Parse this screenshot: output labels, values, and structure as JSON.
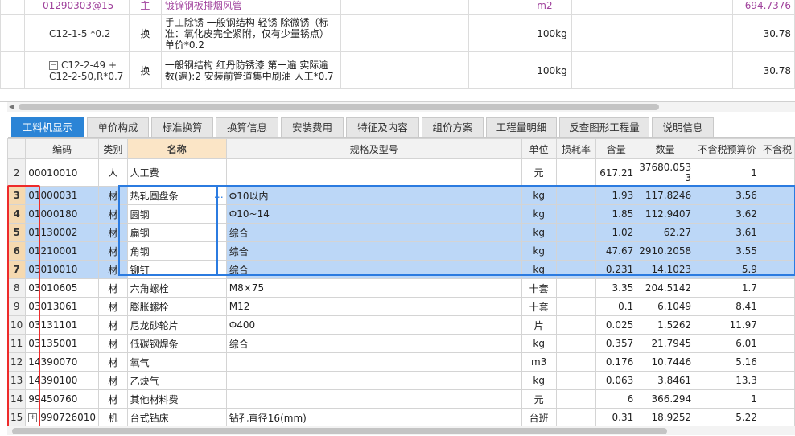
{
  "upper_grid": {
    "rows": [
      {
        "code": "01290303@15",
        "type": "主",
        "desc": "镀锌钢板排烟风管",
        "unit": "m2",
        "value": "694.7376"
      },
      {
        "code": "C12-1-5 *0.2",
        "type": "换",
        "desc": "手工除锈 一般钢结构 轻锈 除微锈（标准：氧化皮完全紧附，仅有少量锈点）单价*0.2",
        "unit": "100kg",
        "value": "30.78"
      },
      {
        "code": "C12-2-49 + C12-2-50,R*0.7",
        "type": "换",
        "desc": "一般钢结构 红丹防锈漆 第一遍 实际遍数(遍):2 安装前管道集中刷油 人工*0.7",
        "unit": "100kg",
        "value": "30.78"
      }
    ]
  },
  "tabs": [
    "工料机显示",
    "单价构成",
    "标准换算",
    "换算信息",
    "安装费用",
    "特征及内容",
    "组价方案",
    "工程量明细",
    "反查图形工程量",
    "说明信息"
  ],
  "columns": [
    "",
    "编码",
    "类别",
    "名称",
    "规格及型号",
    "单位",
    "损耗率",
    "含量",
    "数量",
    "不含税预算价",
    "不含税"
  ],
  "rows": [
    {
      "no": "2",
      "code": "00010010",
      "type": "人",
      "name": "人工费",
      "spec": "",
      "unit": "元",
      "loss": "",
      "qty": "617.21",
      "amount": "37680.0533",
      "price": "1",
      "sel": false
    },
    {
      "no": "3",
      "code": "01000031",
      "type": "材",
      "name": "热轧圆盘条",
      "spec": "Φ10以内",
      "unit": "kg",
      "loss": "",
      "qty": "1.93",
      "amount": "117.8246",
      "price": "3.56",
      "sel": true
    },
    {
      "no": "4",
      "code": "01000180",
      "type": "材",
      "name": "圆钢",
      "spec": "Φ10~14",
      "unit": "kg",
      "loss": "",
      "qty": "1.85",
      "amount": "112.9407",
      "price": "3.62",
      "sel": true
    },
    {
      "no": "5",
      "code": "01130002",
      "type": "材",
      "name": "扁钢",
      "spec": "综合",
      "unit": "kg",
      "loss": "",
      "qty": "1.02",
      "amount": "62.27",
      "price": "3.61",
      "sel": true
    },
    {
      "no": "6",
      "code": "01210001",
      "type": "材",
      "name": "角钢",
      "spec": "综合",
      "unit": "kg",
      "loss": "",
      "qty": "47.67",
      "amount": "2910.2058",
      "price": "3.55",
      "sel": true
    },
    {
      "no": "7",
      "code": "03010010",
      "type": "材",
      "name": "铆钉",
      "spec": "综合",
      "unit": "kg",
      "loss": "",
      "qty": "0.231",
      "amount": "14.1023",
      "price": "5.9",
      "sel": true
    },
    {
      "no": "8",
      "code": "03010605",
      "type": "材",
      "name": "六角螺栓",
      "spec": "M8×75",
      "unit": "十套",
      "loss": "",
      "qty": "3.35",
      "amount": "204.5142",
      "price": "1.7",
      "sel": false
    },
    {
      "no": "9",
      "code": "03013061",
      "type": "材",
      "name": "膨胀螺栓",
      "spec": "M12",
      "unit": "十套",
      "loss": "",
      "qty": "0.1",
      "amount": "6.1049",
      "price": "8.41",
      "sel": false
    },
    {
      "no": "10",
      "code": "03131101",
      "type": "材",
      "name": "尼龙砂轮片",
      "spec": "Φ400",
      "unit": "片",
      "loss": "",
      "qty": "0.025",
      "amount": "1.5262",
      "price": "11.97",
      "sel": false
    },
    {
      "no": "11",
      "code": "03135001",
      "type": "材",
      "name": "低碳钢焊条",
      "spec": "综合",
      "unit": "kg",
      "loss": "",
      "qty": "0.357",
      "amount": "21.7945",
      "price": "6.01",
      "sel": false
    },
    {
      "no": "12",
      "code": "14390070",
      "type": "材",
      "name": "氧气",
      "spec": "",
      "unit": "m3",
      "loss": "",
      "qty": "0.176",
      "amount": "10.7446",
      "price": "5.16",
      "sel": false
    },
    {
      "no": "13",
      "code": "14390100",
      "type": "材",
      "name": "乙炔气",
      "spec": "",
      "unit": "kg",
      "loss": "",
      "qty": "0.063",
      "amount": "3.8461",
      "price": "13.3",
      "sel": false
    },
    {
      "no": "14",
      "code": "99450760",
      "type": "材",
      "name": "其他材料费",
      "spec": "",
      "unit": "元",
      "loss": "",
      "qty": "6",
      "amount": "366.294",
      "price": "1",
      "sel": false
    },
    {
      "no": "15",
      "code": "990726010",
      "type": "机",
      "name": "台式钻床",
      "spec": "钻孔直径16(mm)",
      "unit": "台班",
      "loss": "",
      "qty": "0.31",
      "amount": "18.9252",
      "price": "5.22",
      "sel": false
    }
  ],
  "colors": {
    "accent": "#2b84d6",
    "selection": "#bcd7f7",
    "highlight": "#ee2b2b"
  }
}
